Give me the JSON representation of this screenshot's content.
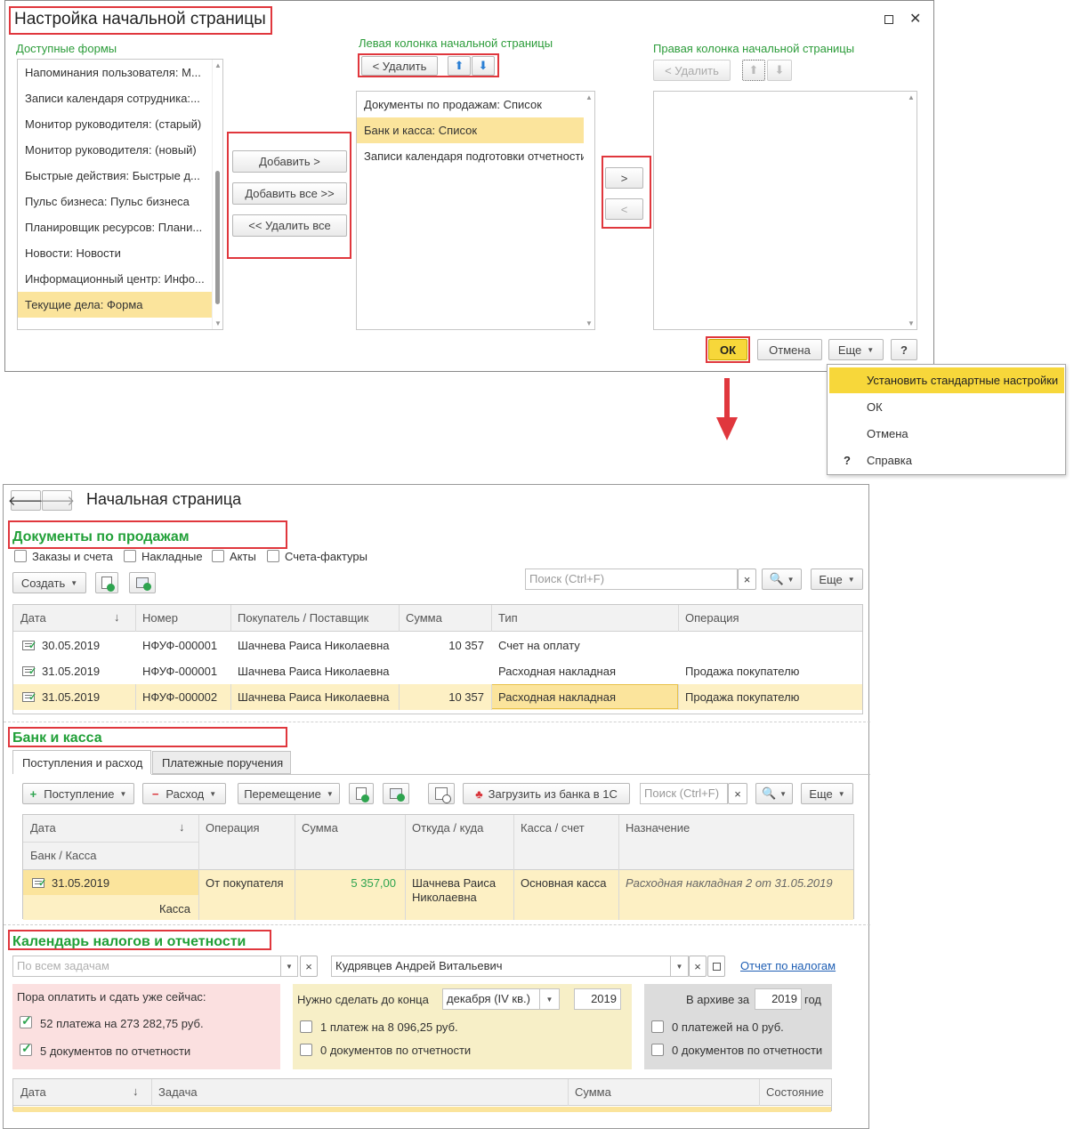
{
  "dialog": {
    "title": "Настройка начальной страницы",
    "available_label": "Доступные формы",
    "available_items": [
      "Напоминания пользователя: М...",
      "Записи календаря сотрудника:...",
      "Монитор руководителя: (старый)",
      "Монитор руководителя: (новый)",
      "Быстрые действия: Быстрые д...",
      "Пульс бизнеса: Пульс бизнеса",
      "Планировщик ресурсов: Плани...",
      "Новости: Новости",
      "Информационный центр: Инфо...",
      "Текущие дела: Форма"
    ],
    "add_label": "Добавить >",
    "add_all_label": "Добавить все >>",
    "remove_all_label": "<< Удалить все",
    "left_col_label": "Левая колонка начальной страницы",
    "left_remove_label": "< Удалить",
    "left_items": [
      "Документы по продажам: Список",
      "Банк и касса: Список",
      "Записи календаря подготовки отчетности"
    ],
    "move_right": ">",
    "move_left": "<",
    "right_col_label": "Правая колонка начальной страницы",
    "right_remove_label": "< Удалить",
    "ok_label": "ОК",
    "cancel_label": "Отмена",
    "more_label": "Еще",
    "help_label": "?"
  },
  "more_menu": {
    "items": [
      "Установить стандартные настройки",
      "ОК",
      "Отмена",
      "Справка"
    ],
    "help_mark": "?"
  },
  "home": {
    "title": "Начальная страница",
    "sales": {
      "title": "Документы по продажам",
      "filters": [
        "Заказы и счета",
        "Накладные",
        "Акты",
        "Счета-фактуры"
      ],
      "create_label": "Создать",
      "search_placeholder": "Поиск (Ctrl+F)",
      "search_clear": "×",
      "more_label": "Еще",
      "columns": [
        "Дата",
        "Номер",
        "Покупатель / Поставщик",
        "Сумма",
        "Тип",
        "Операция"
      ],
      "sort_mark": "↓",
      "rows": [
        [
          "30.05.2019",
          "НФУФ-000001",
          "Шачнева Раиса Николаевна",
          "10 357",
          "Счет на оплату",
          ""
        ],
        [
          "31.05.2019",
          "НФУФ-000001",
          "Шачнева Раиса Николаевна",
          "",
          "Расходная накладная",
          "Продажа покупателю"
        ],
        [
          "31.05.2019",
          "НФУФ-000002",
          "Шачнева Раиса Николаевна",
          "10 357",
          "Расходная накладная",
          "Продажа покупателю"
        ]
      ]
    },
    "bank": {
      "title": "Банк и касса",
      "tabs": [
        "Поступления и расход",
        "Платежные поручения"
      ],
      "income_label": "Поступление",
      "expense_label": "Расход",
      "transfer_label": "Перемещение",
      "load_label": "Загрузить из банка в 1С",
      "search_placeholder": "Поиск (Ctrl+F)",
      "search_clear": "×",
      "more_label": "Еще",
      "plus": "+",
      "minus": "−",
      "columns": [
        "Дата",
        "Операция",
        "Сумма",
        "Откуда / куда",
        "Касса / счет",
        "Назначение"
      ],
      "subcolumn": "Банк / Касса",
      "sort_mark": "↓",
      "row": {
        "date": "31.05.2019",
        "account_type": "Касса",
        "operation": "От покупателя",
        "sum": "5 357,00",
        "from_to_1": "Шачнева Раиса",
        "from_to_2": "Николаевна",
        "cash_account": "Основная касса",
        "purpose": "Расходная накладная 2 от 31.05.2019"
      }
    },
    "tax": {
      "title": "Календарь налогов и отчетности",
      "task_placeholder": "По всем задачам",
      "person": "Кудрявцев Андрей Витальевич",
      "report_link": "Отчет по налогам",
      "clear": "×",
      "now_title": "Пора оплатить и сдать уже сейчас:",
      "now_payments": "52 платежа на 273 282,75 руб.",
      "now_docs": "5 документов по отчетности",
      "todo_title": "Нужно сделать до конца",
      "todo_period": "декабря (IV кв.)",
      "todo_year": "2019",
      "todo_payments": "1 платеж на 8 096,25 руб.",
      "todo_docs": "0 документов по отчетности",
      "archive_title": "В архиве за",
      "archive_year": "2019",
      "archive_suffix": "год",
      "archive_payments": "0 платежей на 0 руб.",
      "archive_docs": "0 документов по отчетности",
      "columns": [
        "Дата",
        "Задача",
        "Сумма",
        "Состояние"
      ],
      "sort_mark": "↓"
    }
  },
  "colors": {
    "accent_green": "#21a038",
    "highlight_red": "#e0373d",
    "selection": "#fbe49c",
    "ok_yellow": "#f7d73a"
  }
}
